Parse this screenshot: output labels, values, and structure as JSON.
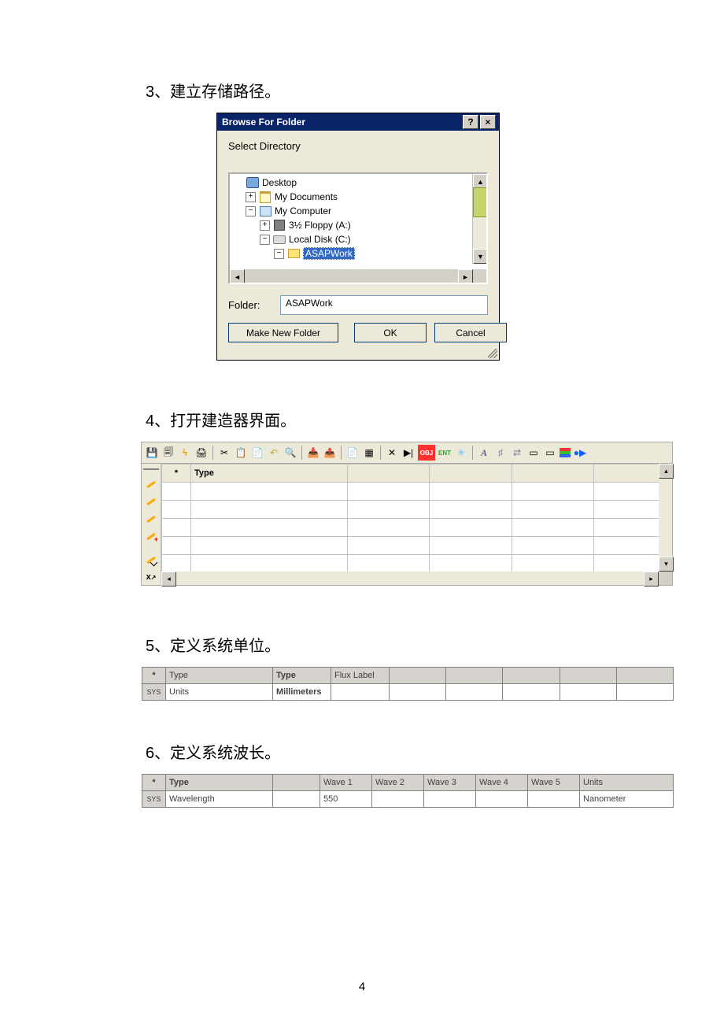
{
  "page_number": "4",
  "steps": {
    "s3": "3、建立存储路径。",
    "s4": "4、打开建造器界面。",
    "s5": "5、定义系统单位。",
    "s6": "6、定义系统波长。"
  },
  "dialog": {
    "title": "Browse For Folder",
    "help_symbol": "?",
    "close_symbol": "×",
    "select_label": "Select Directory",
    "tree": {
      "desktop": "Desktop",
      "mydocs": "My Documents",
      "mycomp": "My Computer",
      "floppy": "3½ Floppy (A:)",
      "localdisk": "Local Disk (C:)",
      "asapwork": "ASAPWork"
    },
    "folder_label": "Folder:",
    "folder_value": "ASAPWork",
    "btn_make": "Make New Folder",
    "btn_ok": "OK",
    "btn_cancel": "Cancel"
  },
  "builder": {
    "header_star": "*",
    "header_type": "Type",
    "toolbar_obj": "OBJ",
    "toolbar_ent": "ENT",
    "toolbar_A": "A"
  },
  "units_table": {
    "h_star": "*",
    "h_type1": "Type",
    "h_type2": "Type",
    "h_flux": "Flux Label",
    "sys": "SYS",
    "row_type": "Units",
    "row_value": "Millimeters"
  },
  "wave_table": {
    "h_star": "*",
    "h_type": "Type",
    "h_w1": "Wave 1",
    "h_w2": "Wave 2",
    "h_w3": "Wave 3",
    "h_w4": "Wave 4",
    "h_w5": "Wave 5",
    "h_units": "Units",
    "sys": "SYS",
    "row_type": "Wavelength",
    "row_w1": "550",
    "row_units": "Nanometer"
  }
}
